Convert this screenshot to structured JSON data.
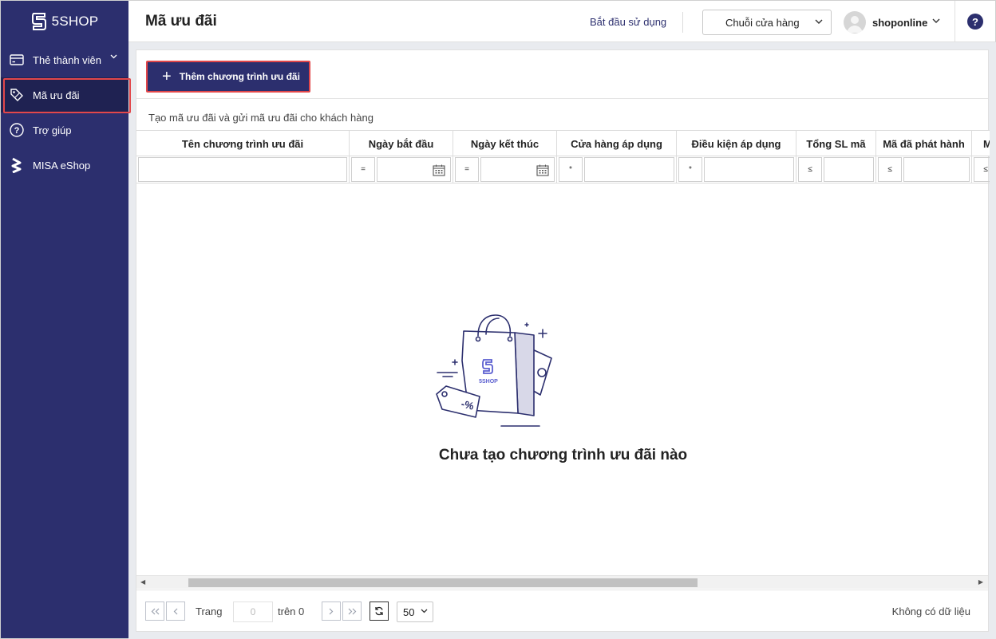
{
  "brand": {
    "name": "5SHOP"
  },
  "sidebar": {
    "items": [
      {
        "label": "Thẻ thành viên",
        "icon": "card-icon",
        "expandable": true
      },
      {
        "label": "Mã ưu đãi",
        "icon": "tag-icon",
        "active": true
      },
      {
        "label": "Trợ giúp",
        "icon": "help-circle-icon"
      },
      {
        "label": "MISA eShop",
        "icon": "misa-logo-icon"
      }
    ]
  },
  "header": {
    "title": "Mã ưu đãi",
    "start_link": "Bắt đầu sử dụng",
    "store_select": "Chuỗi cửa hàng",
    "user": "shoponline",
    "help": "?"
  },
  "toolbar": {
    "add_button": "Thêm chương trình ưu đãi",
    "subtitle": "Tạo mã ưu đãi và gửi mã ưu đãi cho khách hàng"
  },
  "table": {
    "columns": [
      "Tên chương trình ưu đãi",
      "Ngày bắt đầu",
      "Ngày kết thúc",
      "Cửa hàng áp dụng",
      "Điều kiện áp dụng",
      "Tổng SL mã",
      "Mã đã phát hành",
      "M"
    ],
    "filter_ops": [
      "=",
      "=",
      "*",
      "*",
      "≤",
      "≤",
      "≤"
    ]
  },
  "empty_state": {
    "message": "Chưa tạo chương trình ưu đãi nào",
    "bag_label": "5SHOP",
    "coupon_label": "-%"
  },
  "pager": {
    "page_label": "Trang",
    "page_value": "0",
    "of_label": "trên 0",
    "page_size": "50",
    "status": "Không có dữ liệu"
  },
  "colors": {
    "sidebar": "#2c2f6e",
    "accent_border": "#e2474a",
    "primary": "#2c2f6e"
  }
}
